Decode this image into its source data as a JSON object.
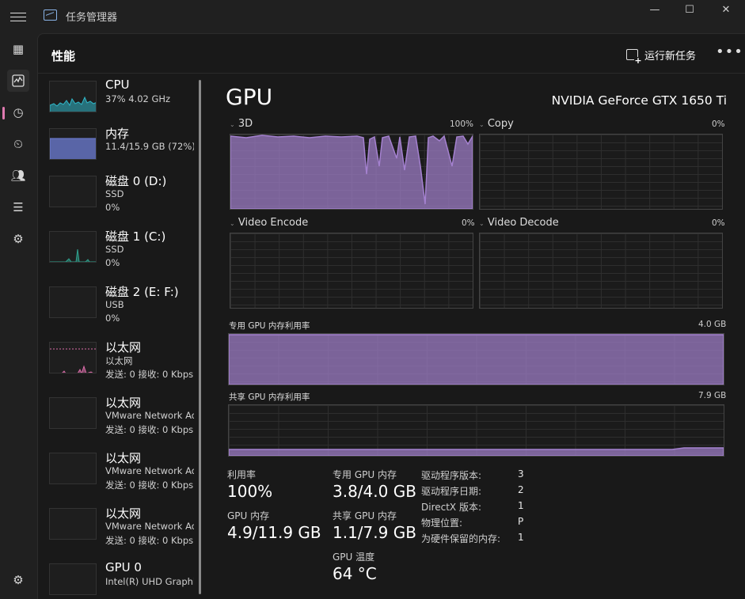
{
  "window": {
    "title": "任务管理器",
    "controls": [
      "minimize-icon",
      "maximize-icon",
      "close-icon"
    ]
  },
  "rail": {
    "items": [
      "processes-icon",
      "performance-icon",
      "app-history-icon",
      "startup-icon",
      "users-icon",
      "details-icon",
      "services-icon"
    ],
    "active": "performance-icon",
    "bottom": "settings-icon"
  },
  "header": {
    "page_title": "性能",
    "run_task_label": "运行新任务",
    "more_label": "•••"
  },
  "devices": [
    {
      "name": "CPU",
      "line1": "37% 4.02 GHz",
      "line2": "",
      "line3": "",
      "accent": "#2fb7c8",
      "kind": "cpu"
    },
    {
      "name": "内存",
      "line1": "11.4/15.9 GB (72%)",
      "line2": "",
      "line3": "",
      "accent": "#6d7ed6",
      "kind": "mem"
    },
    {
      "name": "磁盘 0 (D:)",
      "line1": "SSD",
      "line2": "0%",
      "line3": "",
      "accent": "#2fa08d",
      "kind": "flat"
    },
    {
      "name": "磁盘 1 (C:)",
      "line1": "SSD",
      "line2": "0%",
      "line3": "",
      "accent": "#2fa08d",
      "kind": "disk1"
    },
    {
      "name": "磁盘 2 (E: F:)",
      "line1": "USB",
      "line2": "0%",
      "line3": "",
      "accent": "#2fa08d",
      "kind": "flat"
    },
    {
      "name": "以太网",
      "line1": "以太网",
      "line2": "发送: 0 接收: 0 Kbps",
      "line3": "",
      "accent": "#d96ca8",
      "kind": "eth"
    },
    {
      "name": "以太网",
      "line1": "VMware Network Adapter",
      "line2": "发送: 0 接收: 0 Kbps",
      "line3": "",
      "accent": "#d96ca8",
      "kind": "flat"
    },
    {
      "name": "以太网",
      "line1": "VMware Network Adapter",
      "line2": "发送: 0 接收: 0 Kbps",
      "line3": "",
      "accent": "#d96ca8",
      "kind": "flat"
    },
    {
      "name": "以太网",
      "line1": "VMware Network Adapter",
      "line2": "发送: 0 接收: 0 Kbps",
      "line3": "",
      "accent": "#d96ca8",
      "kind": "flat"
    },
    {
      "name": "GPU 0",
      "line1": "Intel(R) UHD Graphics",
      "line2": "",
      "line3": "",
      "accent": "#a07fd0",
      "kind": "flat"
    }
  ],
  "gpu": {
    "title": "GPU",
    "model": "NVIDIA GeForce GTX 1650 Ti",
    "accent": "#a481cf",
    "engines": [
      {
        "label": "3D",
        "pct": "100%"
      },
      {
        "label": "Copy",
        "pct": "0%"
      },
      {
        "label": "Video Encode",
        "pct": "0%"
      },
      {
        "label": "Video Decode",
        "pct": "0%"
      }
    ],
    "dedicated": {
      "label": "专用 GPU 内存利用率",
      "max": "4.0 GB",
      "fill": 1.0
    },
    "shared": {
      "label": "共享 GPU 内存利用率",
      "max": "7.9 GB",
      "fill": 0.15
    },
    "stats": {
      "util_label": "利用率",
      "util_value": "100%",
      "gpumem_label": "GPU 内存",
      "gpumem_value": "4.9/11.9 GB",
      "ded_label": "专用 GPU 内存",
      "ded_value": "3.8/4.0 GB",
      "shared_label": "共享 GPU 内存",
      "shared_value": "1.1/7.9 GB",
      "temp_label": "GPU 温度",
      "temp_value": "64 °C"
    },
    "driver": [
      {
        "label": "驱动程序版本:",
        "value": "3"
      },
      {
        "label": "驱动程序日期:",
        "value": "2"
      },
      {
        "label": "DirectX 版本:",
        "value": "1"
      },
      {
        "label": "物理位置:",
        "value": "P"
      },
      {
        "label": "为硬件保留的内存:",
        "value": "1"
      }
    ]
  }
}
